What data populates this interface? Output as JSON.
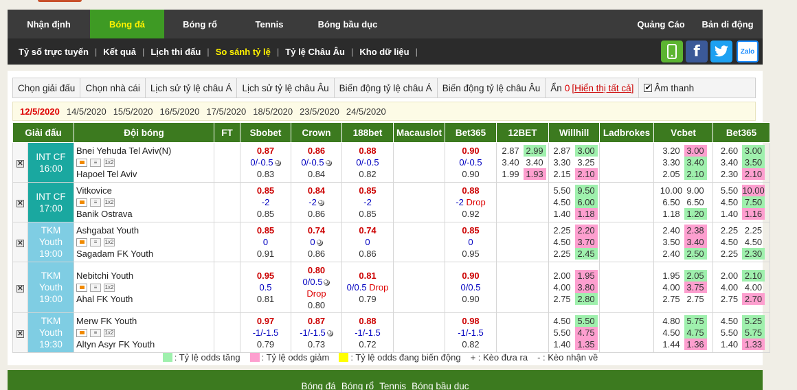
{
  "nav": {
    "top_items": [
      "Nhận định",
      "Bóng đá",
      "Bóng rổ",
      "Tennis",
      "Bóng bầu dục"
    ],
    "active_top": "Bóng đá",
    "right_items": [
      "Quảng Cáo",
      "Bản di động"
    ],
    "sub_items": [
      "Tỷ số trực tuyến",
      "Kết quả",
      "Lịch thi đấu",
      "So sánh tỷ lệ",
      "Tỷ lệ Châu Âu",
      "Kho dữ liệu"
    ],
    "active_sub": "So sánh tỷ lệ",
    "social": {
      "mobile": "phone-icon",
      "facebook": "f",
      "twitter": "twitter-icon",
      "zalo": "Zalo"
    }
  },
  "toolbar": {
    "items": [
      "Chọn giải đấu",
      "Chọn nhà cái",
      "Lịch sử tỷ lệ châu Á",
      "Lịch sử tỷ lệ châu Âu",
      "Biến động tỷ lệ châu Á",
      "Biến động tỷ lệ châu Âu"
    ],
    "hidden_label": "Ẩn",
    "hidden_count": "0",
    "show_all": "[Hiển thị tất cả]",
    "sound_label": "Âm thanh",
    "sound_checked": "✔"
  },
  "dates": [
    "12/5/2020",
    "14/5/2020",
    "15/5/2020",
    "16/5/2020",
    "17/5/2020",
    "18/5/2020",
    "23/5/2020",
    "24/5/2020"
  ],
  "table": {
    "headers": [
      "Giải đấu",
      "Đội bóng",
      "FT",
      "Sbobet",
      "Crown",
      "188bet",
      "Macauslot",
      "Bet365",
      "12BET",
      "Willhill",
      "Ladbrokes",
      "Vcbet",
      "Bet365"
    ],
    "remove_mark": "✕",
    "icon_1x2": "1x2",
    "icon_list": "≡",
    "matches": [
      {
        "league": "INT CF",
        "league_sub": "",
        "time": "16:00",
        "league_color": "#1aa8a0",
        "home": "Bnei Yehuda Tel Aviv(N)",
        "away": "Hapoel Tel Aviv",
        "sbobet": [
          "0.87",
          "0/-0.5",
          "0.83"
        ],
        "sbobet_drop": "",
        "crown": [
          "0.86",
          "0/-0.5",
          "0.84"
        ],
        "crown_drop": "",
        "b188": [
          "0.88",
          "0/-0.5",
          "0.82"
        ],
        "b188_drop": "",
        "bet365a": [
          "0.90",
          "0/-0.5",
          "0.90"
        ],
        "bet365a_drop": "",
        "b12": [
          [
            "2.87",
            "2.99"
          ],
          [
            "3.40",
            "3.40"
          ],
          [
            "1.99",
            "1.93"
          ]
        ],
        "willhill": [
          [
            "2.87",
            "3.00"
          ],
          [
            "3.30",
            "3.25"
          ],
          [
            "2.15",
            "2.10"
          ]
        ],
        "vcbet": [
          [
            "3.20",
            "3.00"
          ],
          [
            "3.30",
            "3.40"
          ],
          [
            "2.05",
            "2.10"
          ]
        ],
        "bet365e": [
          [
            "2.60",
            "3.00"
          ],
          [
            "3.40",
            "3.50"
          ],
          [
            "2.30",
            "2.10"
          ]
        ]
      },
      {
        "league": "INT CF",
        "league_sub": "",
        "time": "17:00",
        "league_color": "#1aa8a0",
        "home": "Vitkovice",
        "away": "Banik Ostrava",
        "sbobet": [
          "0.85",
          "-2",
          "0.85"
        ],
        "sbobet_drop": "",
        "crown": [
          "0.84",
          "-2",
          "0.86"
        ],
        "crown_drop": "",
        "b188": [
          "0.85",
          "-2",
          "0.85"
        ],
        "b188_drop": "",
        "bet365a": [
          "0.88",
          "-2",
          "0.92"
        ],
        "bet365a_drop": "Drop",
        "b12": [
          [
            "",
            ""
          ],
          [
            "",
            ""
          ],
          [
            "",
            ""
          ]
        ],
        "willhill": [
          [
            "5.50",
            "9.50"
          ],
          [
            "4.50",
            "6.00"
          ],
          [
            "1.40",
            "1.18"
          ]
        ],
        "vcbet": [
          [
            "10.00",
            "9.00"
          ],
          [
            "6.50",
            "6.50"
          ],
          [
            "1.18",
            "1.20"
          ]
        ],
        "bet365e": [
          [
            "5.50",
            "10.00"
          ],
          [
            "4.50",
            "7.50"
          ],
          [
            "1.40",
            "1.16"
          ]
        ]
      },
      {
        "league": "TKM",
        "league_sub": "Youth",
        "time": "19:00",
        "league_color": "#7fcde3",
        "home": "Ashgabat Youth",
        "away": "Sagadam FK Youth",
        "sbobet": [
          "0.85",
          "0",
          "0.91"
        ],
        "sbobet_drop": "",
        "crown": [
          "0.74",
          "0",
          "0.86"
        ],
        "crown_drop": "",
        "b188": [
          "0.74",
          "0",
          "0.86"
        ],
        "b188_drop": "",
        "bet365a": [
          "0.85",
          "0",
          "0.95"
        ],
        "bet365a_drop": "",
        "b12": [
          [
            "",
            ""
          ],
          [
            "",
            ""
          ],
          [
            "",
            ""
          ]
        ],
        "willhill": [
          [
            "2.25",
            "2.20"
          ],
          [
            "4.50",
            "3.70"
          ],
          [
            "2.25",
            "2.45"
          ]
        ],
        "vcbet": [
          [
            "2.40",
            "2.38"
          ],
          [
            "3.50",
            "3.40"
          ],
          [
            "2.40",
            "2.50"
          ]
        ],
        "bet365e": [
          [
            "2.25",
            "2.25"
          ],
          [
            "4.50",
            "4.50"
          ],
          [
            "2.25",
            "2.30"
          ]
        ]
      },
      {
        "league": "TKM",
        "league_sub": "Youth",
        "time": "19:00",
        "league_color": "#7fcde3",
        "home": "Nebitchi Youth",
        "away": "Ahal FK Youth",
        "sbobet": [
          "0.95",
          "0.5",
          "0.81"
        ],
        "sbobet_drop": "",
        "crown": [
          "0.80",
          "0/0.5",
          "0.80"
        ],
        "crown_drop": "Drop",
        "b188": [
          "0.81",
          "0/0.5",
          "0.79"
        ],
        "b188_drop": "Drop",
        "bet365a": [
          "0.90",
          "0/0.5",
          "0.90"
        ],
        "bet365a_drop": "",
        "b12": [
          [
            "",
            ""
          ],
          [
            "",
            ""
          ],
          [
            "",
            ""
          ]
        ],
        "willhill": [
          [
            "2.00",
            "1.95"
          ],
          [
            "4.00",
            "3.80"
          ],
          [
            "2.75",
            "2.80"
          ]
        ],
        "vcbet": [
          [
            "1.95",
            "2.05"
          ],
          [
            "4.00",
            "3.75"
          ],
          [
            "2.75",
            "2.75"
          ]
        ],
        "bet365e": [
          [
            "2.00",
            "2.10"
          ],
          [
            "4.00",
            "4.00"
          ],
          [
            "2.75",
            "2.70"
          ]
        ]
      },
      {
        "league": "TKM",
        "league_sub": "Youth",
        "time": "19:30",
        "league_color": "#7fcde3",
        "home": "Merw FK Youth",
        "away": "Altyn Asyr FK Youth",
        "sbobet": [
          "0.97",
          "-1/-1.5",
          "0.79"
        ],
        "sbobet_drop": "",
        "crown": [
          "0.87",
          "-1/-1.5",
          "0.73"
        ],
        "crown_drop": "",
        "b188": [
          "0.88",
          "-1/-1.5",
          "0.72"
        ],
        "b188_drop": "",
        "bet365a": [
          "0.98",
          "-1/-1.5",
          "0.82"
        ],
        "bet365a_drop": "",
        "b12": [
          [
            "",
            ""
          ],
          [
            "",
            ""
          ],
          [
            "",
            ""
          ]
        ],
        "willhill": [
          [
            "4.50",
            "5.50"
          ],
          [
            "5.50",
            "4.75"
          ],
          [
            "1.40",
            "1.35"
          ]
        ],
        "vcbet": [
          [
            "4.80",
            "5.75"
          ],
          [
            "4.50",
            "4.75"
          ],
          [
            "1.44",
            "1.36"
          ]
        ],
        "bet365e": [
          [
            "4.50",
            "5.25"
          ],
          [
            "5.50",
            "5.75"
          ],
          [
            "1.40",
            "1.33"
          ]
        ]
      }
    ]
  },
  "legend": {
    "up": ": Tỷ lệ odds tăng",
    "down": ": Tỷ lệ odds giảm",
    "changing": ": Tỷ lệ odds đang biến động",
    "plus": "+ : Kèo đưa ra",
    "minus": "- : Kèo nhận về"
  },
  "footer": [
    "Bóng đá",
    "Bóng rổ",
    "Tennis",
    "Bóng bầu dục"
  ],
  "colors": {
    "green": "#3c7a1f",
    "nav_active": "#3e9a24",
    "up": "#9ff0ad",
    "down": "#fd9fcf",
    "changing": "#ffff00",
    "facebook": "#3b5998",
    "twitter": "#1da1f2",
    "mobile": "#5cb531",
    "zalo": "#1a8cff"
  }
}
